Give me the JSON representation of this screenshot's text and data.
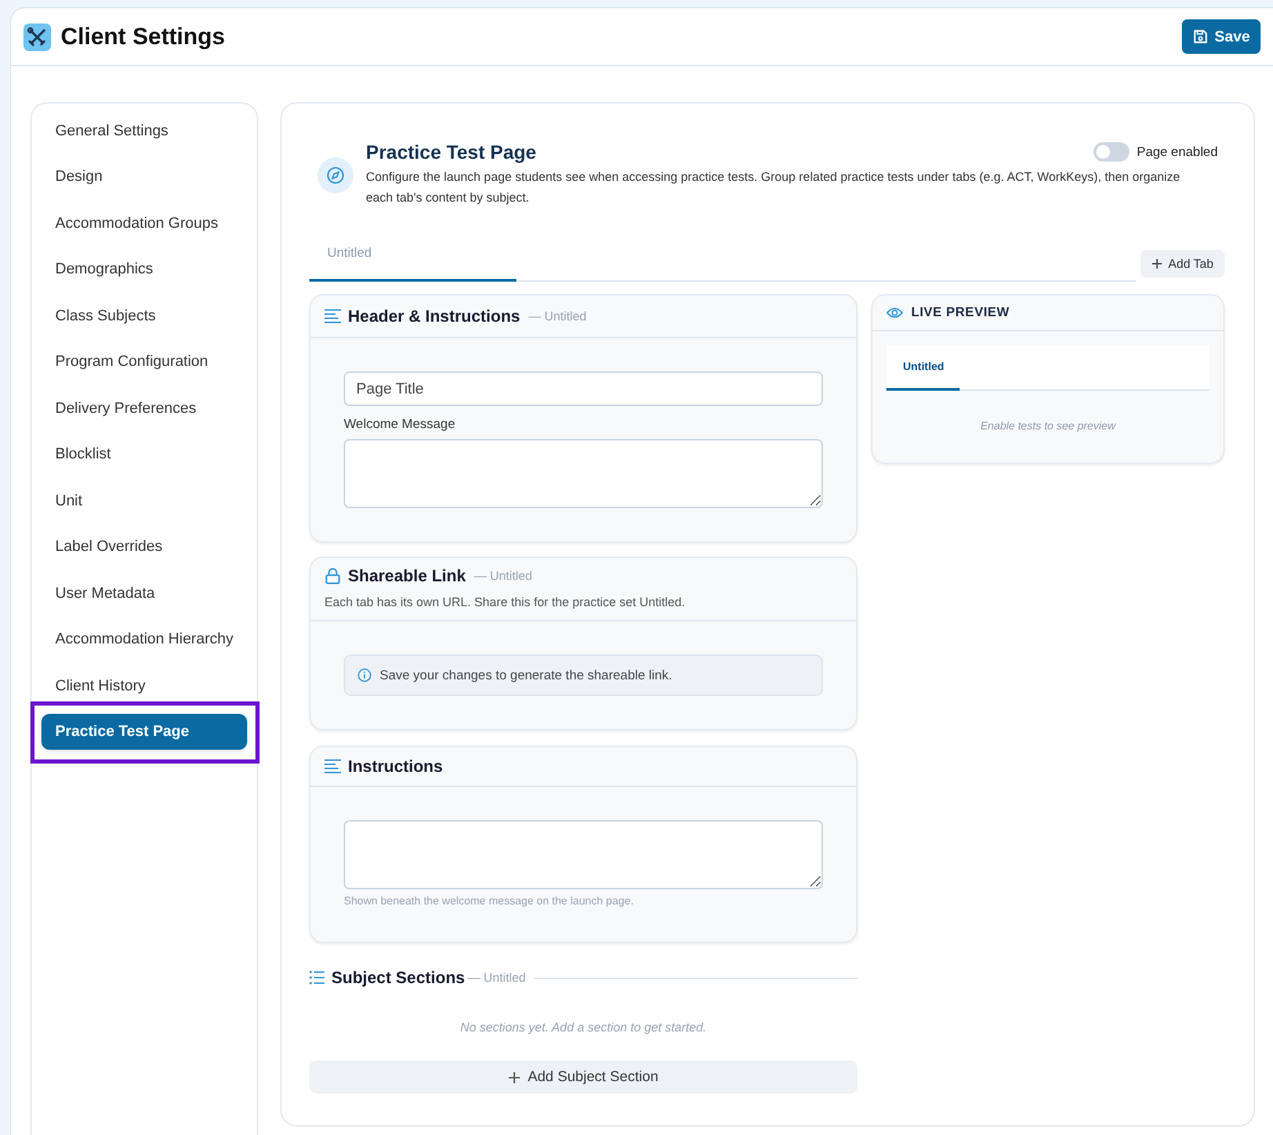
{
  "header": {
    "title": "Client Settings",
    "save_button": "Save"
  },
  "sidebar": {
    "items": [
      {
        "label": "General Settings",
        "selected": false,
        "highlighted": false
      },
      {
        "label": "Design",
        "selected": false,
        "highlighted": false
      },
      {
        "label": "Accommodation Groups",
        "selected": false,
        "highlighted": false
      },
      {
        "label": "Demographics",
        "selected": false,
        "highlighted": false
      },
      {
        "label": "Class Subjects",
        "selected": false,
        "highlighted": false
      },
      {
        "label": "Program Configuration",
        "selected": false,
        "highlighted": false
      },
      {
        "label": "Delivery Preferences",
        "selected": false,
        "highlighted": false
      },
      {
        "label": "Blocklist",
        "selected": false,
        "highlighted": false
      },
      {
        "label": "Unit",
        "selected": false,
        "highlighted": false
      },
      {
        "label": "Label Overrides",
        "selected": false,
        "highlighted": false
      },
      {
        "label": "User Metadata",
        "selected": false,
        "highlighted": false
      },
      {
        "label": "Accommodation Hierarchy",
        "selected": false,
        "highlighted": false
      },
      {
        "label": "Client History",
        "selected": false,
        "highlighted": false
      },
      {
        "label": "Practice Test Page",
        "selected": true,
        "highlighted": true
      }
    ]
  },
  "page": {
    "title": "Practice Test Page",
    "description": "Configure the launch page students see when accessing practice tests. Group related practice tests under tabs (e.g. ACT, WorkKeys), then organize each tab's content by subject.",
    "toggle": {
      "label": "Page enabled",
      "on": false
    }
  },
  "tabs": [
    {
      "label": "Untitled",
      "selected": true
    }
  ],
  "add_tab": "Add Tab",
  "header_card": {
    "title": "Header & Instructions",
    "subtitle": "— Untitled",
    "title_field": {
      "value": "Page Title"
    },
    "welcome_label": "Welcome Message"
  },
  "link_card": {
    "title": "Shareable Link",
    "subtitle": "— Untitled",
    "description": "Each tab has its own URL. Share this for the practice set Untitled.",
    "notice": "Save your changes to generate the shareable link."
  },
  "instructions_card": {
    "title": "Instructions",
    "hint": "Shown beneath the welcome message on the launch page."
  },
  "subject_sections": {
    "title": "Subject Sections",
    "subtitle": "— Untitled",
    "empty": "No sections yet. Add a section to get started.",
    "add_button": "Add Subject Section"
  },
  "preview": {
    "title": "LIVE PREVIEW",
    "tabs": [
      {
        "label": "Untitled",
        "selected": true
      }
    ],
    "empty": "Enable tests to see preview"
  }
}
